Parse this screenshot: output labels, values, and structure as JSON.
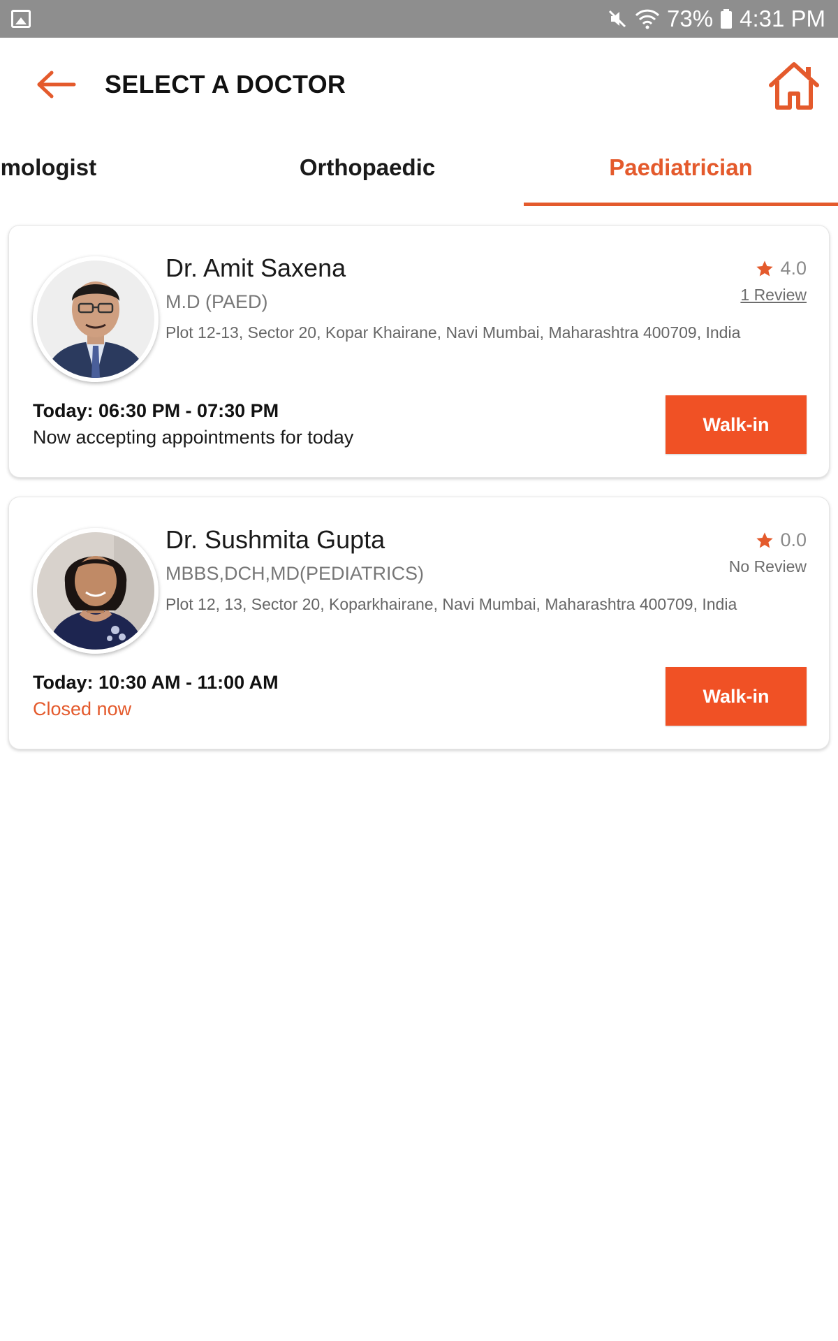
{
  "status_bar": {
    "battery": "73%",
    "time": "4:31 PM"
  },
  "header": {
    "title": "SELECT A DOCTOR"
  },
  "tabs": [
    {
      "label": "Opthalmologist",
      "visible_label": "thalmologist"
    },
    {
      "label": "Orthopaedic"
    },
    {
      "label": "Paediatrician",
      "selected": true
    }
  ],
  "doctors": [
    {
      "name": "Dr. Amit Saxena",
      "degree": "M.D (PAED)",
      "address": "Plot 12-13, Sector 20, Kopar Khairane, Navi Mumbai, Maharashtra 400709, India",
      "rating": "4.0",
      "reviews": "1 Review",
      "hours": "Today: 06:30 PM - 07:30 PM",
      "status": "Now accepting appointments for today",
      "action": "Walk-in"
    },
    {
      "name": "Dr. Sushmita Gupta",
      "degree": "MBBS,DCH,MD(PEDIATRICS)",
      "address": "Plot 12, 13, Sector 20, Koparkhairane, Navi Mumbai, Maharashtra 400709, India",
      "rating": "0.0",
      "reviews": "No Review",
      "hours": "Today: 10:30 AM - 11:00 AM",
      "status": "Closed now",
      "action": "Walk-in"
    }
  ],
  "colors": {
    "accent": "#e45a2c",
    "button": "#f05125",
    "status_bar": "#8e8e8e"
  }
}
